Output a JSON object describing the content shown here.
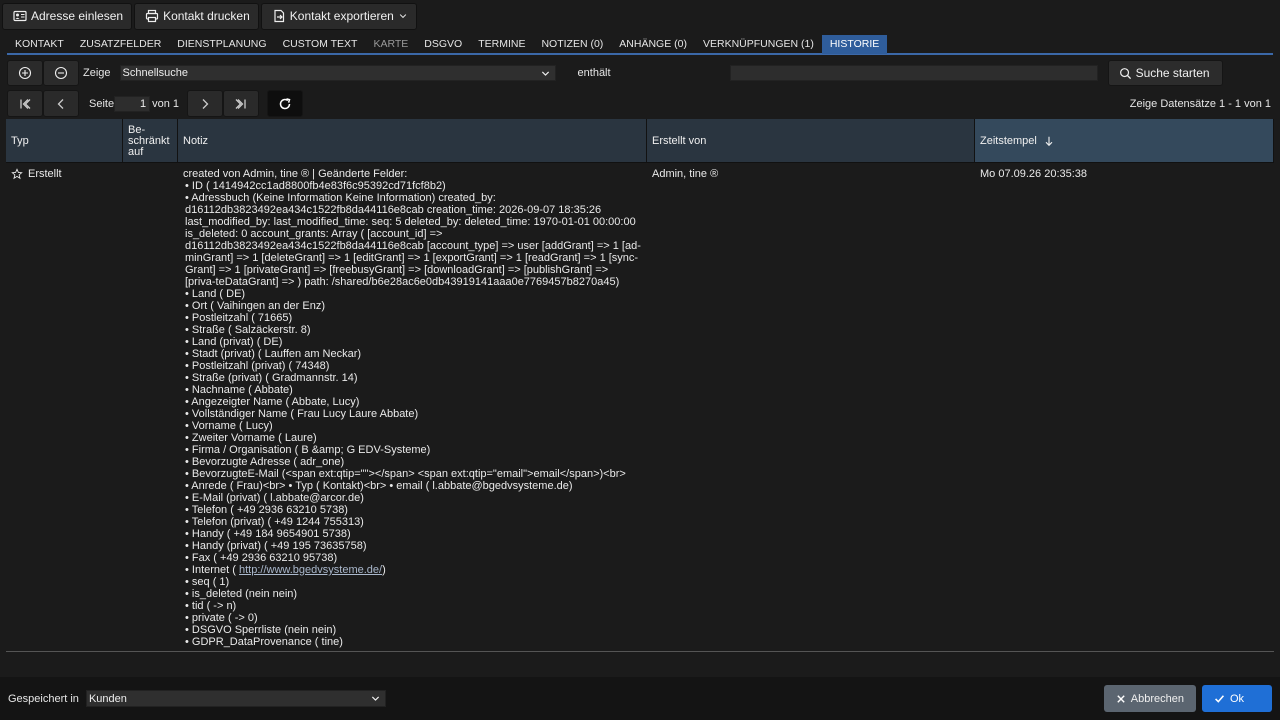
{
  "toolbar": {
    "import_label": "Adresse einlesen",
    "print_label": "Kontakt drucken",
    "export_label": "Kontakt exportieren"
  },
  "tabs": [
    {
      "label": "Kontakt"
    },
    {
      "label": "Zusatzfelder"
    },
    {
      "label": "Dienstplanung"
    },
    {
      "label": "Custom Text"
    },
    {
      "label": "Karte"
    },
    {
      "label": "DSGVO"
    },
    {
      "label": "Termine"
    },
    {
      "label": "Notizen (0)"
    },
    {
      "label": "Anhänge (0)"
    },
    {
      "label": "Verknüpfungen (1)"
    },
    {
      "label": "Historie"
    }
  ],
  "filter": {
    "show_label": "Zeige",
    "field_value": "Schnellsuche",
    "operator": "enthält",
    "search_value": "",
    "search_label": "Suche starten"
  },
  "pager": {
    "page_label": "Seite",
    "page_value": "1",
    "of_label": "von 1",
    "records_label": "Zeige Datensätze 1 - 1 von 1"
  },
  "grid": {
    "columns": {
      "type": "Typ",
      "restricted": "Be-\nschränkt\nauf",
      "note": "Notiz",
      "created_by": "Erstellt von",
      "timestamp": "Zeitstempel"
    },
    "row": {
      "type": "Erstellt",
      "note_lines": [
        "created von Admin, tine ® | Geänderte Felder:",
        "•  ID (  1414942cc1ad8800fb4e83f6c95392cd71fcf8b2)",
        "•  Adressbuch (Keine Information  Keine Information) created_by: d16112db3823492ea434c1522fb8da44116e8cab creation_time: 2026-09-07 18:35:26 last_modified_by: last_modified_time: seq: 5 deleted_by: deleted_time: 1970-01-01 00:00:00 is_deleted: 0 account_grants: Array ( [account_id] => d16112db3823492ea434c1522fb8da44116e8cab [account_type] => user [addGrant] => 1 [ad-minGrant] => 1 [deleteGrant] => 1 [editGrant] => 1 [exportGrant] => 1 [readGrant] => 1 [sync-Grant] => 1 [privateGrant] => [freebusyGrant] => [downloadGrant] => [publishGrant] => [priva-teDataGrant] => ) path: /shared/b6e28ac6e0db43919141aaa0e7769457b8270a45)",
        "•  Land (  DE)",
        "•  Ort (  Vaihingen an der Enz)",
        "•  Postleitzahl (  71665)",
        "•  Straße (  Salzäckerstr. 8)",
        "•  Land (privat) (  DE)",
        "•  Stadt (privat) (  Lauffen am Neckar)",
        "•  Postleitzahl (privat) (  74348)",
        "•  Straße (privat) (  Gradmannstr. 14)",
        "•  Nachname (  Abbate)",
        "•  Angezeigter Name (  Abbate, Lucy)",
        "•  Vollständiger Name (  Frau Lucy Laure Abbate)",
        "•  Vorname (  Lucy)",
        "•  Zweiter Vorname (  Laure)",
        "•  Firma / Organisation (  B &amp; G EDV-Systeme)",
        "•  Bevorzugte Adresse (  adr_one)",
        "•  BevorzugteE-Mail (<span ext:qtip=\"\"></span>  <span ext:qtip=\"email\">email</span>)<br>",
        "•  Anrede (  Frau)<br>  •  Typ (  Kontakt)<br>  •  email (  l.abbate@bgedvsysteme.de)",
        "•  E-Mail (privat) (  l.abbate@arcor.de)",
        "•  Telefon (  +49 2936 63210 5738)",
        "•  Telefon (privat) (  +49 1244 755313)",
        "•  Handy (  +49 184 9654901 5738)",
        "•  Handy (privat) (  +49 195 73635758)",
        "•  Fax (  +49 2936 63210 95738)",
        "•  seq (  1)",
        "•  is_deleted (nein  nein)",
        "•  tid ( -> n)",
        "•  private ( -> 0)",
        "•  DSGVO Sperrliste (nein  nein)",
        "•  GDPR_DataProvenance (  tine)"
      ],
      "internet_prefix": "•  Internet (  ",
      "internet_link": "http://www.bgedvsysteme.de/",
      "internet_suffix": ")",
      "created_by": "Admin, tine ®",
      "timestamp": "Mo 07.09.26 20:35:38"
    }
  },
  "footer": {
    "saved_in_label": "Gespeichert in",
    "container_value": "Kunden",
    "cancel_label": "Abbrechen",
    "ok_label": "Ok"
  }
}
